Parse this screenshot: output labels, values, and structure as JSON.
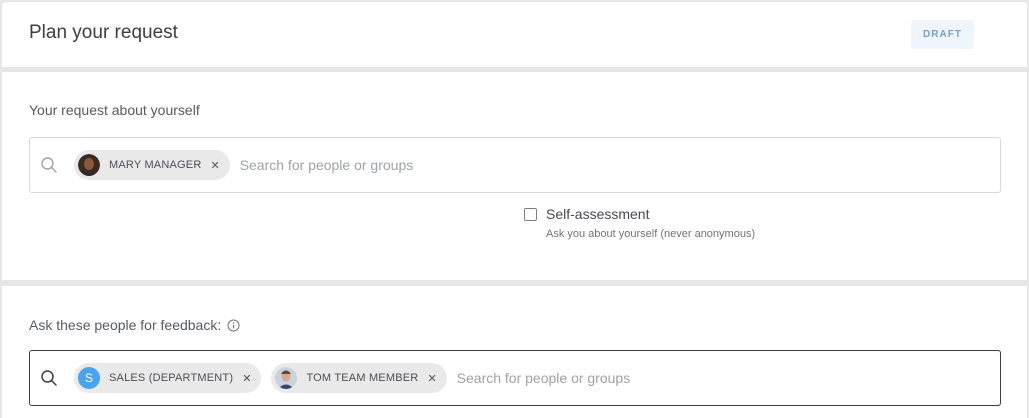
{
  "header": {
    "title": "Plan your request",
    "status": "DRAFT"
  },
  "self_section": {
    "label": "Your request about yourself",
    "chips": [
      {
        "label": "MARY MANAGER",
        "avatar": "photo"
      }
    ],
    "placeholder": "Search for people or groups",
    "self_assessment": {
      "label": "Self-assessment",
      "help": "Ask you about yourself (never anonymous)",
      "checked": false
    }
  },
  "feedback_section": {
    "label": "Ask these people for feedback:",
    "chips": [
      {
        "label": "SALES (DEPARTMENT)",
        "avatar_letter": "S"
      },
      {
        "label": "TOM TEAM MEMBER",
        "avatar": "photo"
      }
    ],
    "placeholder": "Search for people or groups"
  },
  "icons": {
    "search": "search-icon",
    "info": "info-icon",
    "remove": "close-icon"
  },
  "colors": {
    "badge_bg": "#eef5fd",
    "badge_text": "#7a9fcc",
    "chip_bg": "#e9e9ea",
    "group_avatar": "#4aa3ee"
  }
}
